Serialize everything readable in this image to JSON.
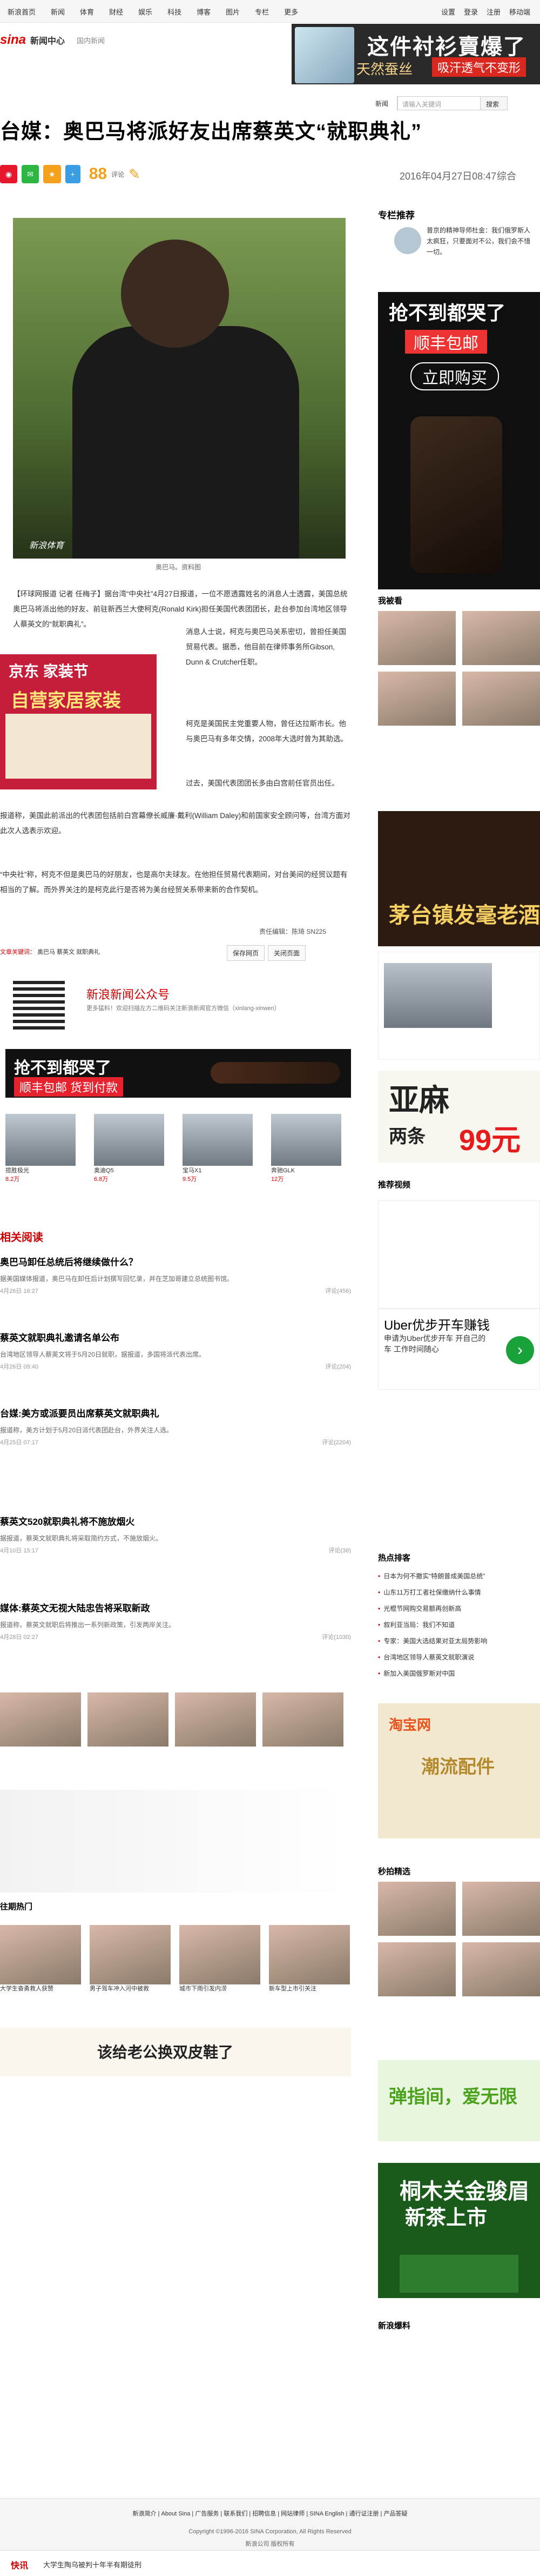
{
  "topnav": {
    "items": [
      "新浪首页",
      "新闻",
      "体育",
      "财经",
      "娱乐",
      "科技",
      "博客",
      "图片",
      "专栏",
      "更多"
    ],
    "right": [
      "设置",
      "登录",
      "注册",
      "移动端"
    ]
  },
  "header": {
    "brand": "sina",
    "section": "新闻中心",
    "crumb": "国内新闻"
  },
  "topad": {
    "title": "这件衬衫賣爆了",
    "sub": "天然蚕丝",
    "cta": "吸汗透气不变形"
  },
  "search": {
    "select": "新闻",
    "placeholder": "请输入关键词",
    "button": "搜索"
  },
  "article": {
    "title": "台媒：奥巴马将派好友出席蔡英文“就职典礼”",
    "date": "2016年04月27日08:47",
    "source": "综合",
    "comments": "88",
    "comments_label": "评论",
    "photo_caption": "奥巴马。资料图",
    "watermark": "新浪体育",
    "paras": [
      "【环球网报道 记者 任梅子】据台湾“中央社”4月27日报道，一位不愿透露姓名的消息人士透露，美国总统奥巴马将派出他的好友、前驻新西兰大使柯克(Ronald Kirk)担任美国代表团团长，赴台参加台湾地区领导人蔡英文的“就职典礼”。",
      "消息人士说，柯克与奥巴马关系密切，曾担任美国贸易代表。据悉，他目前在律师事务所Gibson, Dunn & Crutcher任职。",
      "柯克是美国民主党重要人物，曾任达拉斯市长。他与奥巴马有多年交情，2008年大选时曾为其助选。",
      "过去，美国代表团团长多由白宫前任官员出任。",
      "报道称，美国此前派出的代表团包括前白宫幕僚长威廉·戴利(William Daley)和前国家安全顾问等，台湾方面对此次人选表示欢迎。",
      "“中央社”称，柯克不但是奥巴马的好朋友，也是高尔夫球友。在他担任贸易代表期间，对台美间的经贸议题有相当的了解。而外界关注的是柯克此行是否将为美台经贸关系带来新的合作契机。"
    ],
    "editor": "责任编辑：陈琦 SN225",
    "tags_label": "文章关键词：",
    "tags": [
      "奥巴马",
      "蔡英文",
      "就职典礼"
    ],
    "btn_print": "保存网页",
    "btn_close": "关闭页面"
  },
  "ads": {
    "jd_title": "京东 家装节",
    "jd_sub": "自营家居家装",
    "wx_title": "新浪新闻公众号",
    "wx_sub": "更多猛料！欢迎扫描左方二维码关注新浪新闻官方微信（xinlang-xinwen）",
    "banner2": "抢不到都哭了",
    "banner2_sub": "顺丰包邮 货到付款",
    "belt_t1": "抢不到都哭了",
    "belt_t2": "顺丰包邮",
    "belt_t3": "立即购买",
    "tea": "茅台镇发毫老酒",
    "linen_t1": "亚麻",
    "linen_t2": "两条",
    "linen_t3": "99元",
    "uber_t1": "Uber优步开车赚钱",
    "uber_t2": "申请为Uber优步开车 开自己的车 工作时间随心",
    "shoe": "该给老公换双皮鞋了",
    "green": "弹指间，爱无限",
    "tea2_t1": "桐木关金骏眉",
    "tea2_t2": "新茶上市"
  },
  "cars": [
    {
      "name": "揽胜极光",
      "price": "8.2万"
    },
    {
      "name": "奥迪Q5",
      "price": "6.8万"
    },
    {
      "name": "宝马X1",
      "price": "9.5万"
    },
    {
      "name": "奔驰GLK",
      "price": "12万"
    }
  ],
  "related": {
    "heading": "相关阅读",
    "items": [
      {
        "t": "奥巴马卸任总统后将继续做什么？",
        "d": "据美国媒体报道，奥巴马在卸任后计划撰写回忆录，并在芝加哥建立总统图书馆。",
        "m": "4月26日 16:27",
        "c": "评论(456)"
      },
      {
        "t": "蔡英文就职典礼邀请名单公布",
        "d": "台湾地区领导人蔡英文将于5月20日就职，据报道，多国将派代表出席。",
        "m": "4月26日 09:40",
        "c": "评论(204)"
      },
      {
        "t": "台媒:美方或派要员出席蔡英文就职典礼",
        "d": "报道称，美方计划于5月20日派代表团赴台，外界关注人选。",
        "m": "4月25日 07:17",
        "c": "评论(2204)"
      },
      {
        "t": "蔡英文520就职典礼将不施放烟火",
        "d": "据报道，蔡英文就职典礼将采取简约方式，不施放烟火。",
        "m": "4月10日 15:17",
        "c": "评论(38)"
      },
      {
        "t": "媒体:蔡英文无视大陆忠告将采取新政",
        "d": "报道称，蔡英文就职后将推出一系列新政策，引发两岸关注。",
        "m": "4月28日 02:27",
        "c": "评论(1030)"
      }
    ]
  },
  "right": {
    "hd": "专栏推荐",
    "col_text": "普京的精神导师杜金：我们俄罗斯人太疯狂，只要面对不公，我们会不惜一切。",
    "watch": "我被看",
    "video": "推荐视频",
    "hot": "热点排客",
    "hot_items": [
      "日本为何不撤实“特朗普成美国总统”",
      "山东11万打工者社保缴纳什么事情",
      "光棍节网购交易额再创新高",
      "叙利亚当局：我们不知道",
      "专家：美国大选结果对亚太局势影响",
      "台湾地区领导人蔡英文就职演说",
      "新加入美国俄罗斯对中国"
    ],
    "spot": "秒拍精选",
    "new": "新浪爆料"
  },
  "feed": {
    "hd": "往期热门",
    "rows": [
      "大学生奋勇救人获赞",
      "男子驾车冲入河中被救",
      "城市下雨引发内涝",
      "新车型上市引关注"
    ]
  },
  "footer": {
    "links": [
      "新浪简介",
      "About Sina",
      "广告服务",
      "联系我们",
      "招聘信息",
      "网站律师",
      "SINA English",
      "通行证注册",
      "产品答疑"
    ],
    "copy": "Copyright ©1996-2016 SINA Corporation, All Rights Reserved",
    "copy2": "新浪公司 版权所有"
  },
  "fixbar": {
    "l1": "快讯",
    "l2": "大学生陶乌被判十年半有期徒刑"
  }
}
